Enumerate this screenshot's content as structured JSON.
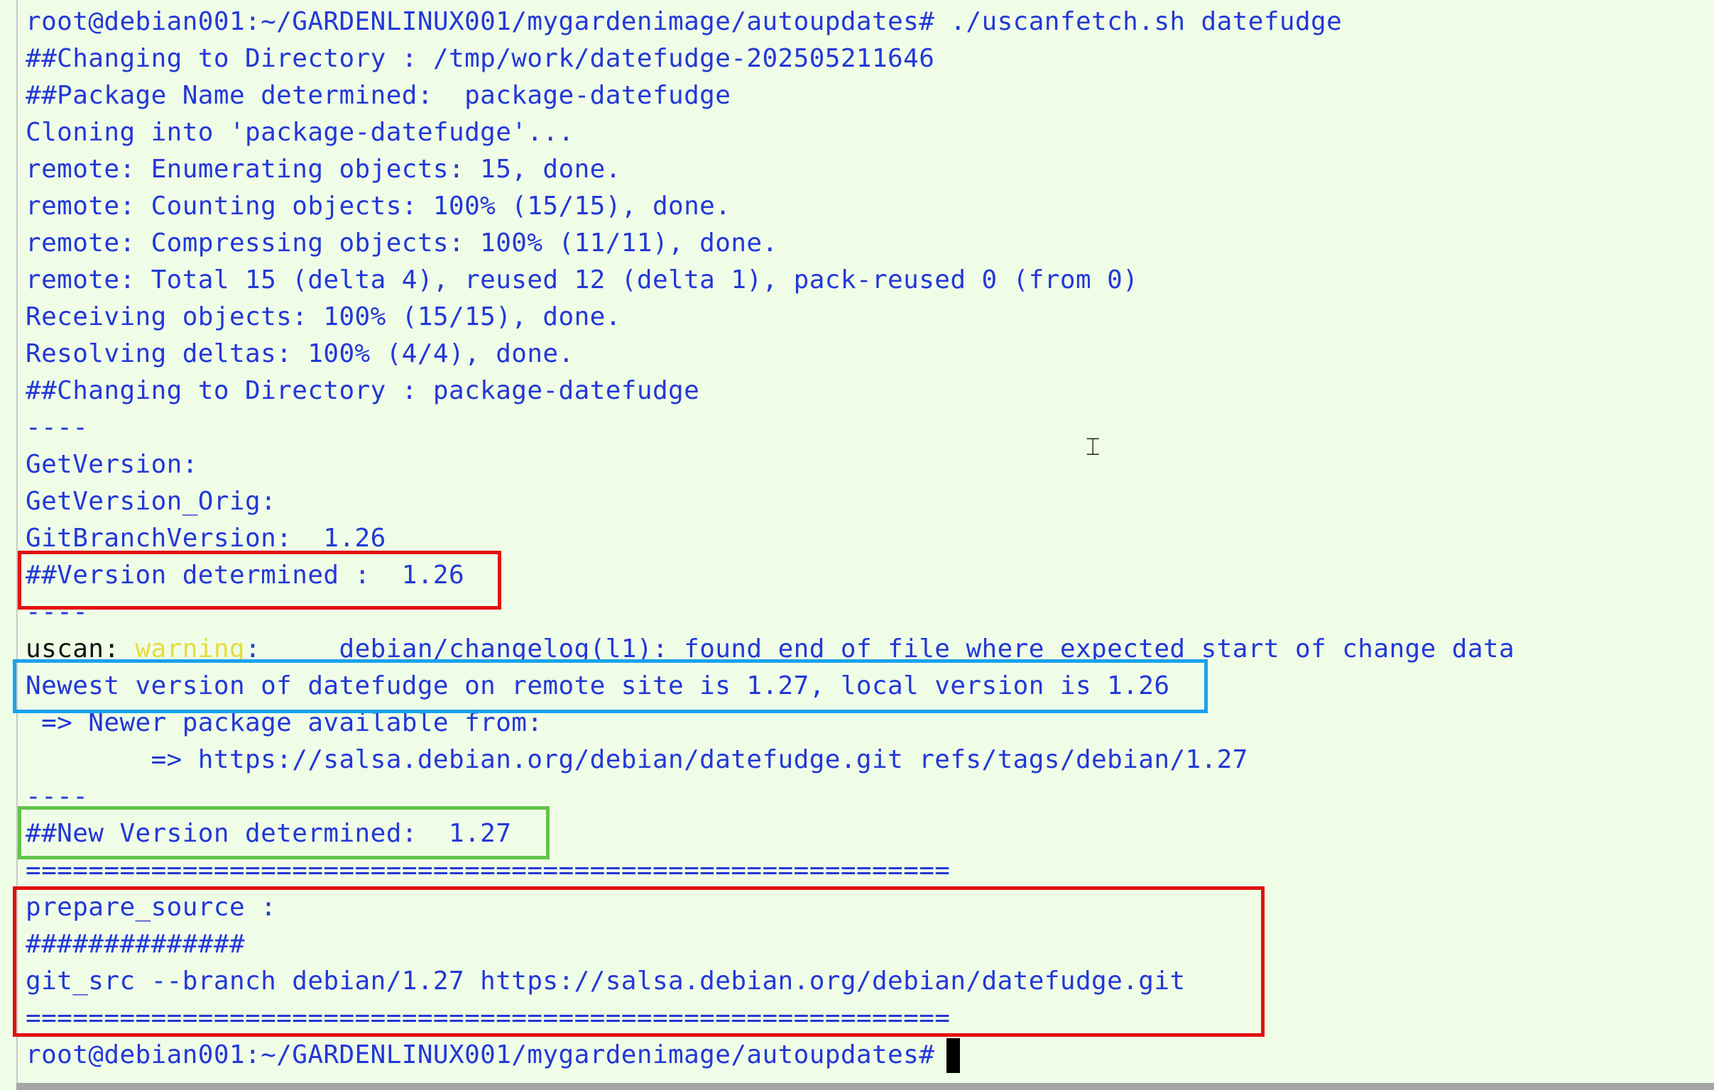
{
  "terminal": {
    "lines": [
      "root@debian001:~/GARDENLINUX001/mygardenimage/autoupdates# ./uscanfetch.sh datefudge",
      "##Changing to Directory : /tmp/work/datefudge-202505211646",
      "##Package Name determined:  package-datefudge",
      "Cloning into 'package-datefudge'...",
      "remote: Enumerating objects: 15, done.",
      "remote: Counting objects: 100% (15/15), done.",
      "remote: Compressing objects: 100% (11/11), done.",
      "remote: Total 15 (delta 4), reused 12 (delta 1), pack-reused 0 (from 0)",
      "Receiving objects: 100% (15/15), done.",
      "Resolving deltas: 100% (4/4), done.",
      "##Changing to Directory : package-datefudge",
      "----",
      "GetVersion:",
      "GetVersion_Orig:",
      "GitBranchVersion:  1.26",
      "##Version determined :  1.26",
      "----"
    ],
    "warning_line": {
      "prefix": "uscan: ",
      "level": "warning",
      "rest": ":     debian/changelog(l1): found end of file where expected start of change data"
    },
    "lines_after": [
      "Newest version of datefudge on remote site is 1.27, local version is 1.26",
      " => Newer package available from:",
      "        => https://salsa.debian.org/debian/datefudge.git refs/tags/debian/1.27",
      "----",
      "##New Version determined:  1.27",
      "===========================================================",
      "prepare_source :",
      "##############",
      "git_src --branch debian/1.27 https://salsa.debian.org/debian/datefudge.git",
      "===========================================================",
      "root@debian001:~/GARDENLINUX001/mygardenimage/autoupdates# "
    ]
  },
  "colors": {
    "background": "#effde7",
    "text": "#2238d8",
    "warning": "#e6dc3c",
    "highlight_red": "#e3100f",
    "highlight_blue": "#1aa1ee",
    "highlight_green": "#62c44a"
  },
  "icons": {
    "mouse_cursor": "text-ibeam-icon",
    "text_cursor": "block-cursor"
  }
}
